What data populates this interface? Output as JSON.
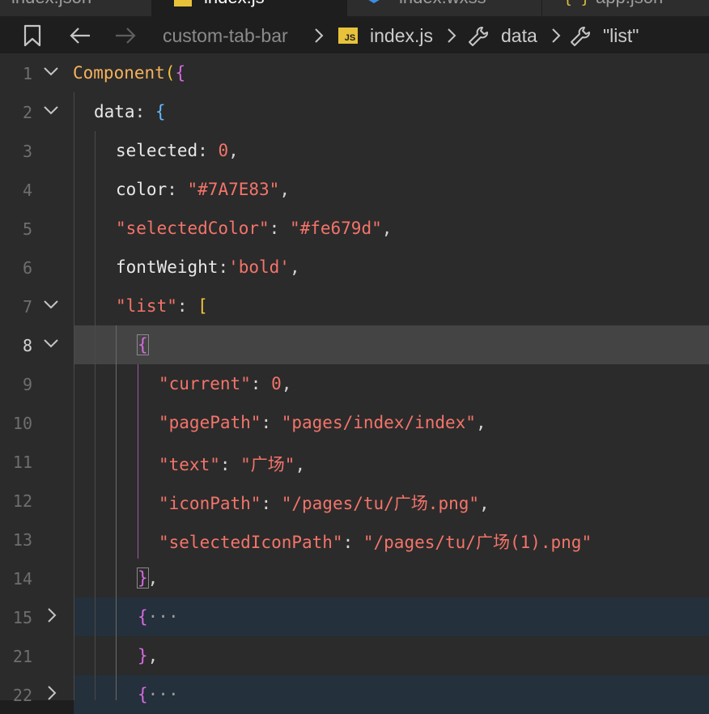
{
  "tabs": [
    {
      "label": "index.json"
    },
    {
      "label": "index.js"
    },
    {
      "label": "index.wxss"
    },
    {
      "label": "app.json"
    }
  ],
  "breadcrumb": {
    "folder": "custom-tab-bar",
    "file": "index.js",
    "file_badge": "JS",
    "symbol1": "data",
    "symbol2": "\"list\""
  },
  "editor": {
    "lines": [
      {
        "n": "1"
      },
      {
        "n": "2"
      },
      {
        "n": "3"
      },
      {
        "n": "4"
      },
      {
        "n": "5"
      },
      {
        "n": "6"
      },
      {
        "n": "7"
      },
      {
        "n": "8"
      },
      {
        "n": "9"
      },
      {
        "n": "10"
      },
      {
        "n": "11"
      },
      {
        "n": "12"
      },
      {
        "n": "13"
      },
      {
        "n": "14"
      },
      {
        "n": "15"
      },
      {
        "n": "21"
      },
      {
        "n": "22"
      }
    ],
    "code": {
      "l1_fn": "Component",
      "l1_paren": "(",
      "l1_brace": "{",
      "l2_key": "data",
      "l2_colon": ": ",
      "l2_brace": "{",
      "l3_key": "selected",
      "l3_colon": ": ",
      "l3_val": "0",
      "l3_comma": ",",
      "l4_key": "color",
      "l4_colon": ": ",
      "l4_val": "\"#7A7E83\"",
      "l4_comma": ",",
      "l5_key": "\"selectedColor\"",
      "l5_colon": ": ",
      "l5_val": "\"#fe679d\"",
      "l5_comma": ",",
      "l6_key": "fontWeight",
      "l6_colon": ":",
      "l6_val": "'bold'",
      "l6_comma": ",",
      "l7_key": "\"list\"",
      "l7_colon": ": ",
      "l7_bracket": "[",
      "l8_brace": "{",
      "l9_key": "\"current\"",
      "l9_colon": ": ",
      "l9_val": "0",
      "l9_comma": ",",
      "l10_key": "\"pagePath\"",
      "l10_colon": ": ",
      "l10_val": "\"pages/index/index\"",
      "l10_comma": ",",
      "l11_key": "\"text\"",
      "l11_colon": ": ",
      "l11_val": "\"广场\"",
      "l11_comma": ",",
      "l12_key": "\"iconPath\"",
      "l12_colon": ": ",
      "l12_val": "\"/pages/tu/广场.png\"",
      "l12_comma": ",",
      "l13_key": "\"selectedIconPath\"",
      "l13_colon": ": ",
      "l13_val": "\"/pages/tu/广场(1).png\"",
      "l14_brace": "}",
      "l14_comma": ",",
      "l15_brace": "{",
      "l15_dots": "···",
      "l21_brace": "}",
      "l21_comma": ",",
      "l22_brace": "{",
      "l22_dots": "···"
    }
  }
}
